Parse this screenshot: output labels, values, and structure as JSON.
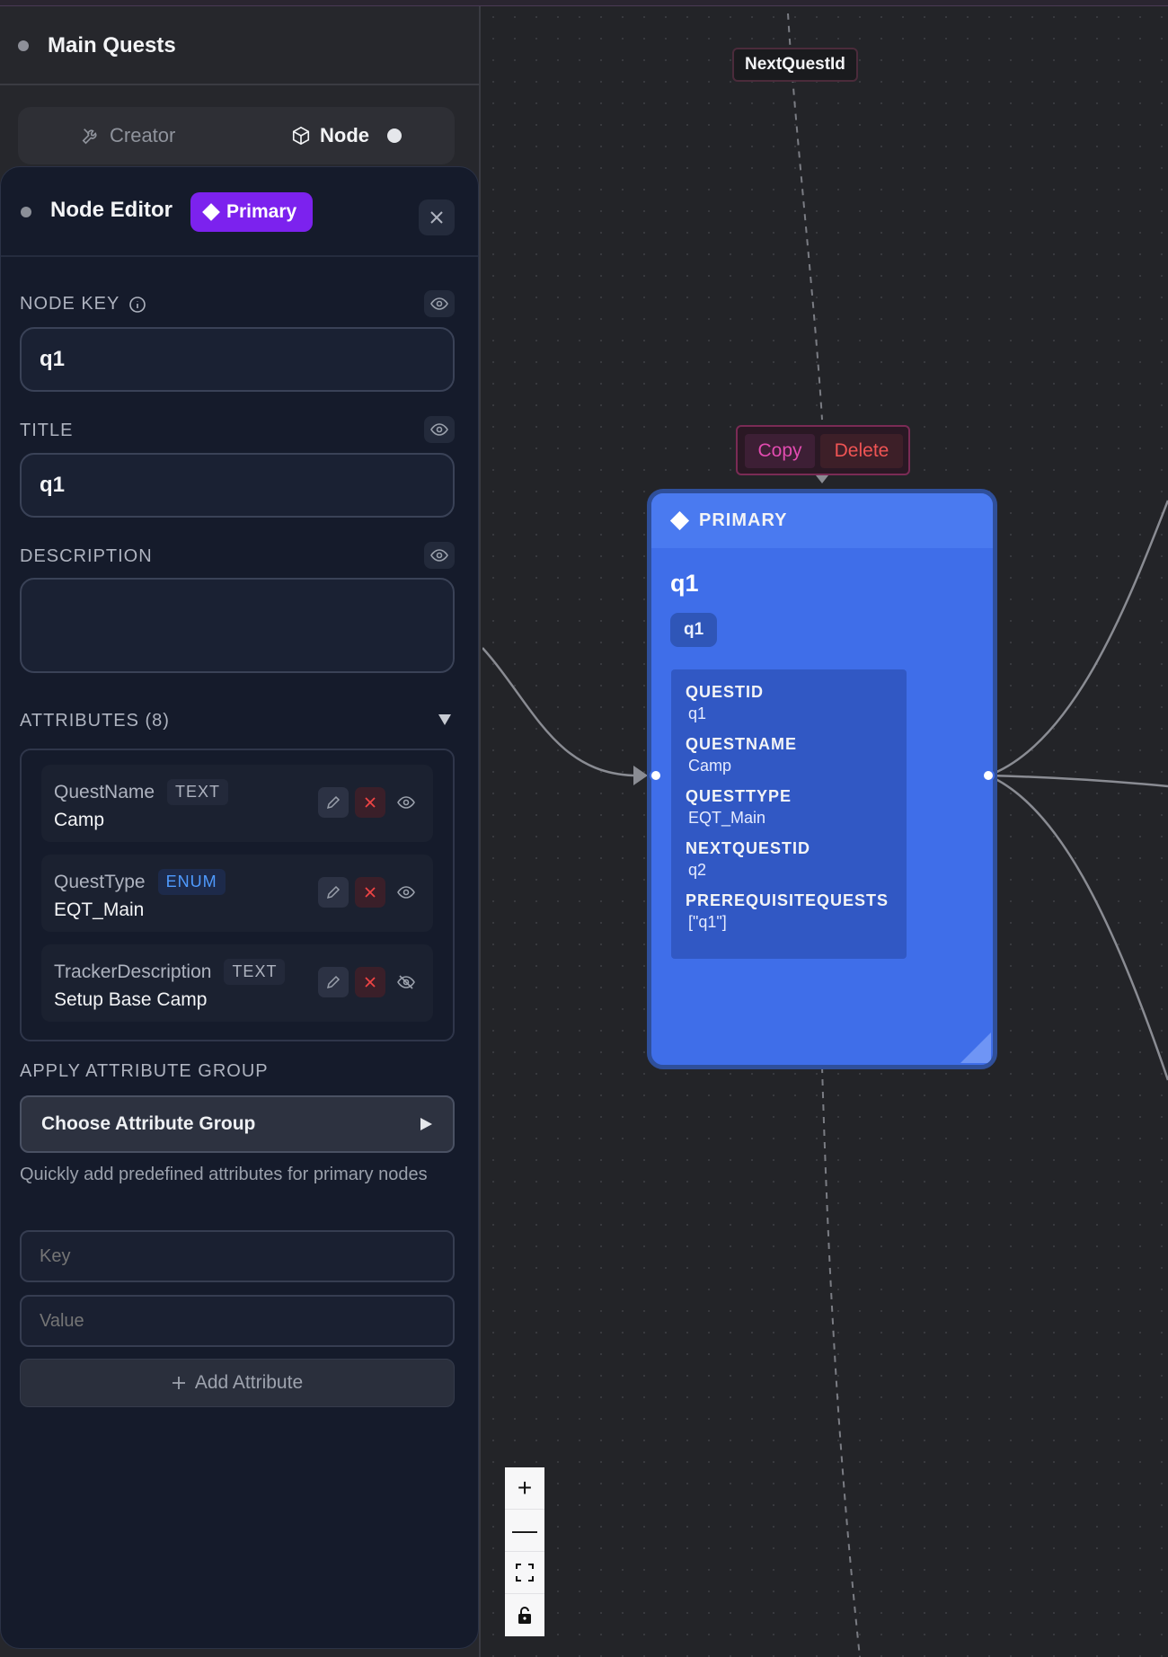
{
  "project": {
    "title": "Main Quests"
  },
  "tabs": {
    "creator": "Creator",
    "node": "Node"
  },
  "editor": {
    "title": "Node Editor",
    "badge": "Primary",
    "node_key_label": "NODE KEY",
    "node_key_value": "q1",
    "title_label": "TITLE",
    "title_value": "q1",
    "description_label": "DESCRIPTION",
    "description_value": "",
    "attributes_label": "ATTRIBUTES (8)",
    "attributes": [
      {
        "name": "QuestName",
        "type": "TEXT",
        "value": "Camp",
        "visible": true
      },
      {
        "name": "QuestType",
        "type": "ENUM",
        "value": "EQT_Main",
        "visible": true
      },
      {
        "name": "TrackerDescription",
        "type": "TEXT",
        "value": "Setup Base Camp",
        "visible": false
      }
    ],
    "apply_group_label": "APPLY ATTRIBUTE GROUP",
    "choose_group": "Choose Attribute Group",
    "hint": "Quickly add predefined attributes for primary nodes",
    "key_placeholder": "Key",
    "value_placeholder": "Value",
    "add_attribute": "Add Attribute"
  },
  "canvas": {
    "edge_label": "NextQuestId",
    "toolbar": {
      "copy": "Copy",
      "delete": "Delete"
    },
    "node": {
      "type": "PRIMARY",
      "title": "q1",
      "key": "q1",
      "attrs": [
        {
          "k": "QUESTID",
          "v": "q1"
        },
        {
          "k": "QUESTNAME",
          "v": "Camp"
        },
        {
          "k": "QUESTTYPE",
          "v": "EQT_Main"
        },
        {
          "k": "NEXTQUESTID",
          "v": "q2"
        },
        {
          "k": "PREREQUISITEQUESTS",
          "v": "[\"q1\"]"
        }
      ]
    },
    "zoom": {
      "in": "+",
      "out": "—"
    }
  },
  "colors": {
    "accent_purple": "#7c22ee",
    "node_blue": "#3f6ee9",
    "delete_red": "#ef5454",
    "copy_pink": "#e24bb0"
  }
}
